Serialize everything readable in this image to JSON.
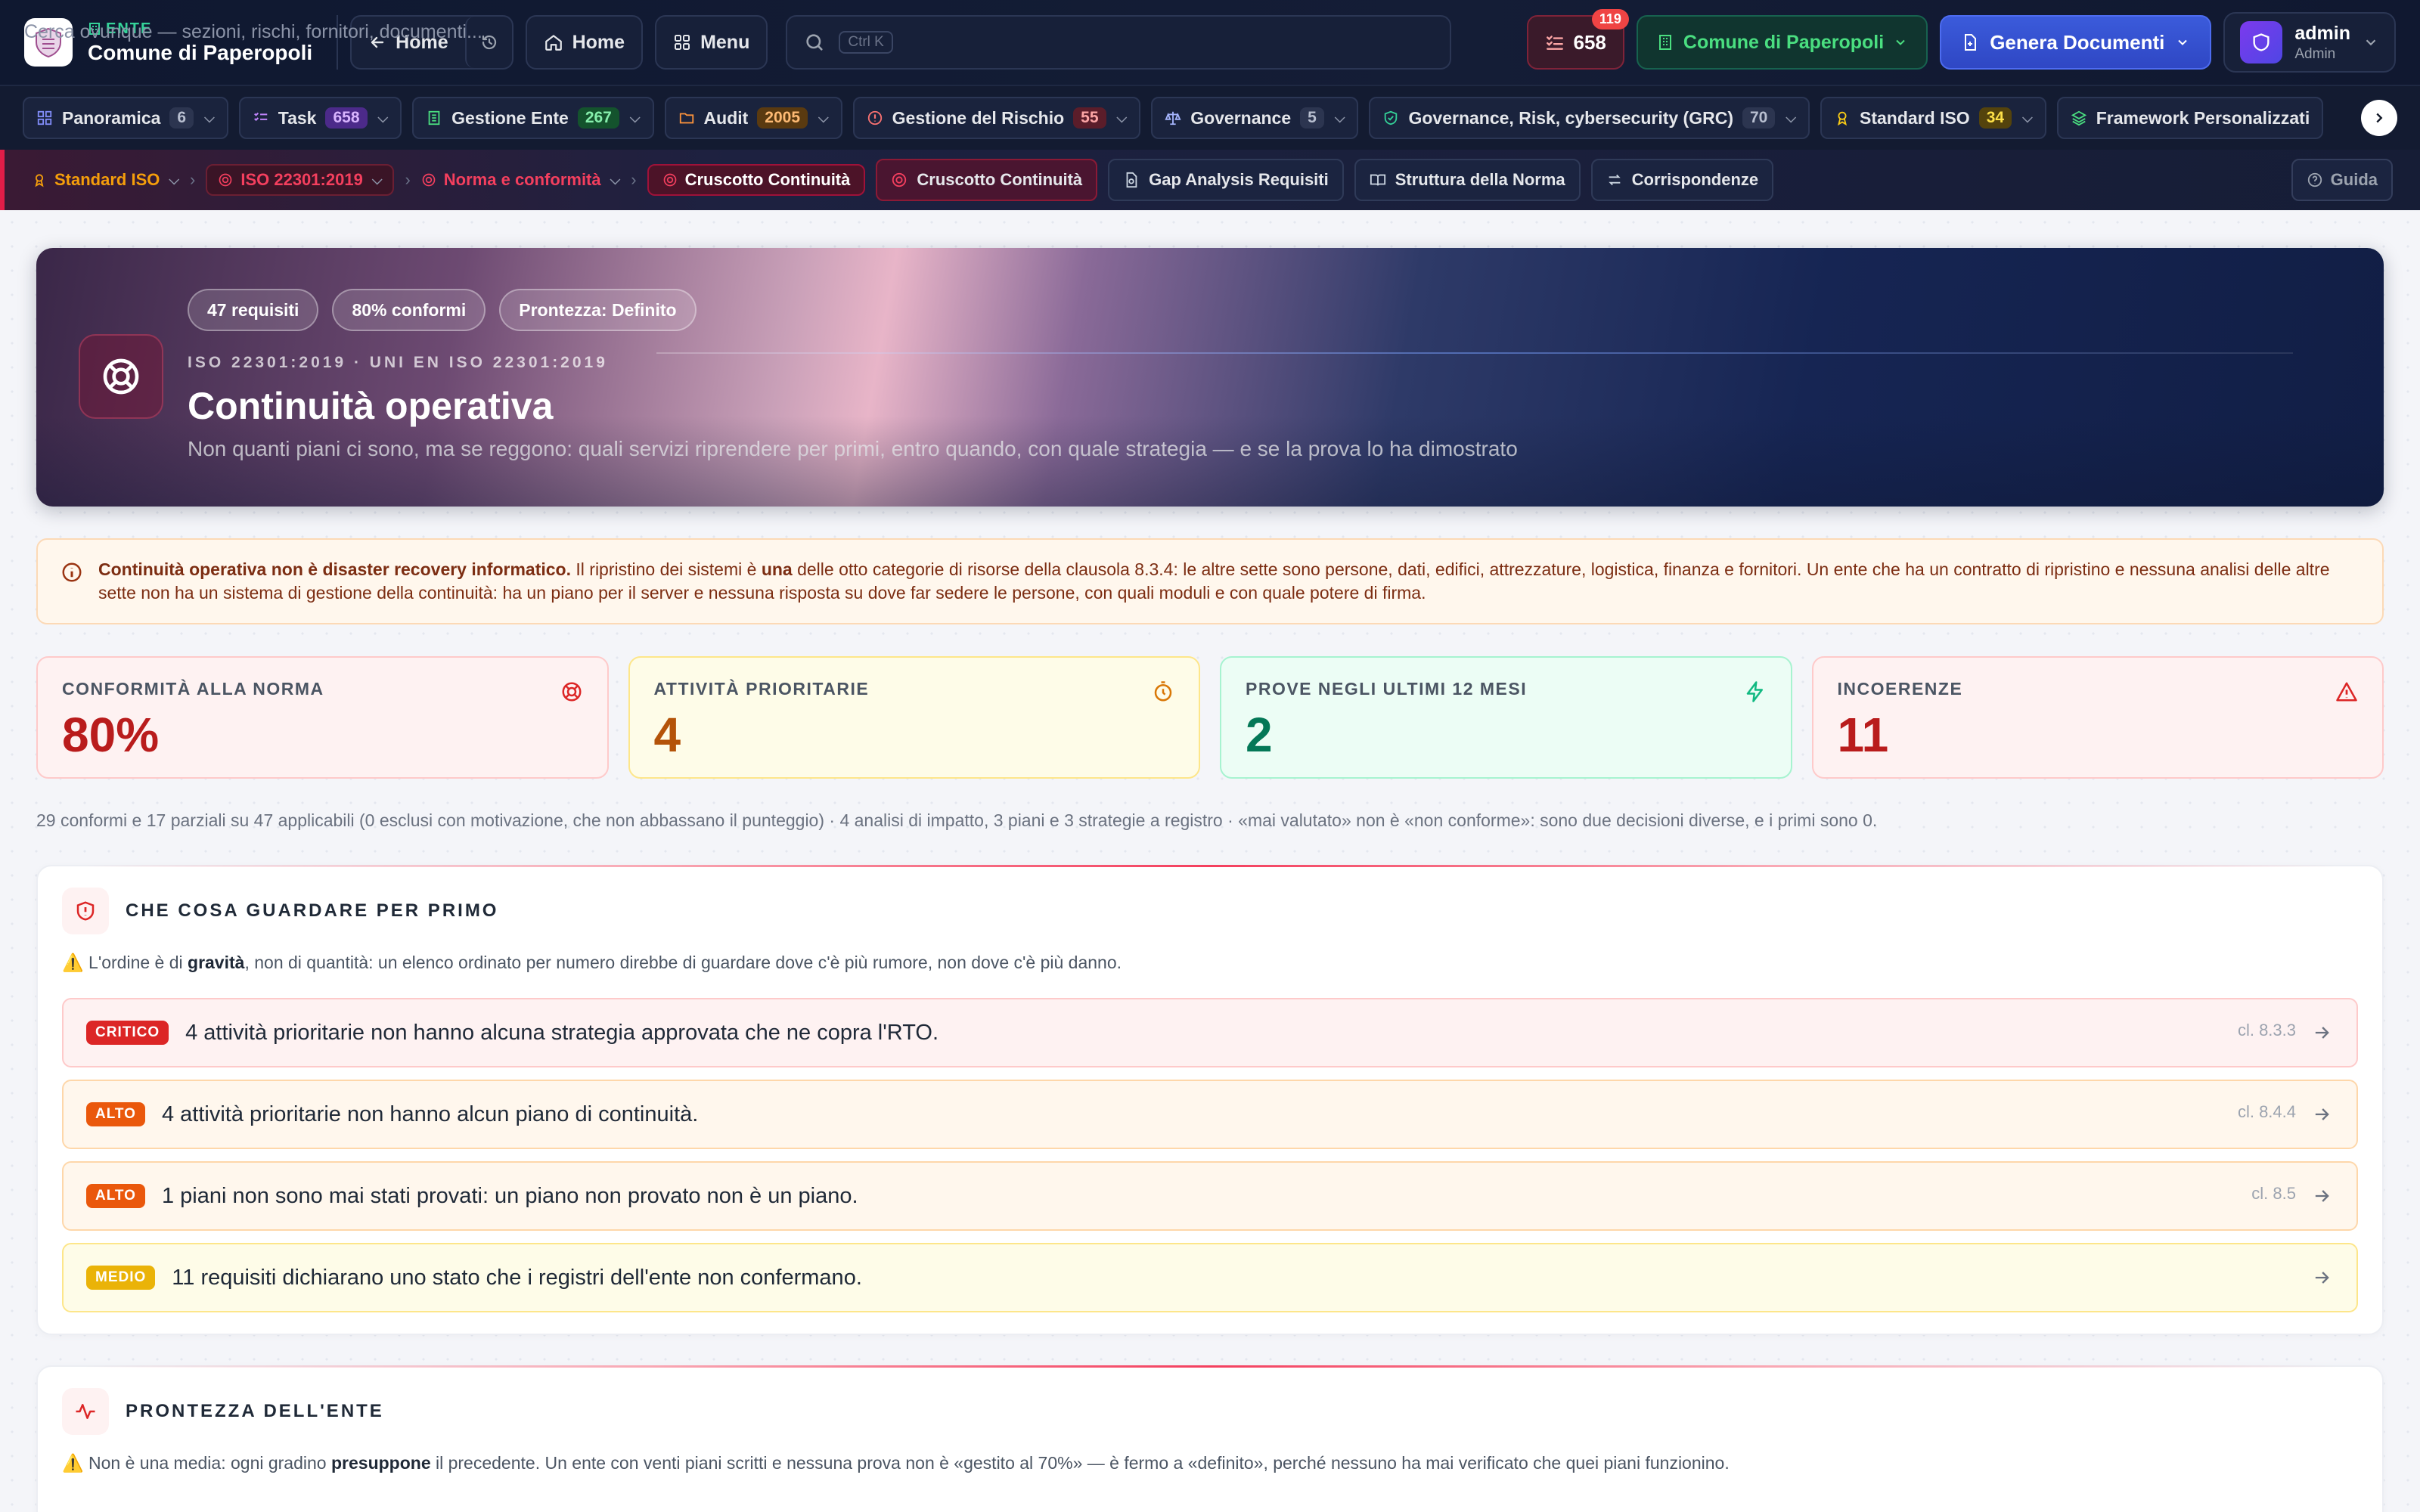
{
  "header": {
    "entity_kicker": "ENTE",
    "entity_name": "Comune di Paperopoli",
    "back_home": "Home",
    "home": "Home",
    "menu": "Menu",
    "search_placeholder": "Cerca ovunque — sezioni, rischi, fornitori, documenti...",
    "search_shortcut": "Ctrl K",
    "tasks_count": "658",
    "tasks_badge": "119",
    "entity_selector": "Comune di Paperopoli",
    "generate_docs": "Genera Documenti",
    "user_name": "admin",
    "user_role": "Admin"
  },
  "modules": [
    {
      "label": "Panoramica",
      "count": "6",
      "count_color": "gray",
      "icon": "grid-icon"
    },
    {
      "label": "Task",
      "count": "658",
      "count_color": "purple",
      "icon": "list-check-icon"
    },
    {
      "label": "Gestione Ente",
      "count": "267",
      "count_color": "green",
      "icon": "building-icon"
    },
    {
      "label": "Audit",
      "count": "2005",
      "count_color": "orange",
      "icon": "folder-icon"
    },
    {
      "label": "Gestione del Rischio",
      "count": "55",
      "count_color": "red",
      "icon": "alert-circle-icon"
    },
    {
      "label": "Governance",
      "count": "5",
      "count_color": "gray",
      "icon": "scale-icon"
    },
    {
      "label": "Governance, Risk, cybersecurity (GRC)",
      "count": "70",
      "count_color": "gray",
      "icon": "shield-check-icon"
    },
    {
      "label": "Standard ISO",
      "count": "34",
      "count_color": "yellow",
      "icon": "award-icon"
    },
    {
      "label": "Framework Personalizzati",
      "count": "",
      "count_color": "gray",
      "icon": "layers-icon"
    }
  ],
  "breadcrumb": {
    "root": "Standard ISO",
    "standard": "ISO 22301:2019",
    "section": "Norma e conformità",
    "current": "Cruscotto Continuità"
  },
  "tabs": [
    {
      "label": "Cruscotto Continuità",
      "icon": "lifebuoy-icon"
    },
    {
      "label": "Gap Analysis Requisiti",
      "icon": "file-search-icon"
    },
    {
      "label": "Struttura della Norma",
      "icon": "book-open-icon"
    },
    {
      "label": "Corrispondenze",
      "icon": "arrows-icon"
    }
  ],
  "guide": "Guida",
  "hero": {
    "chips": [
      "47 requisiti",
      "80% conformi",
      "Prontezza: Definito"
    ],
    "kicker": "ISO 22301:2019 · UNI EN ISO 22301:2019",
    "title": "Continuità operativa",
    "subtitle": "Non quanti piani ci sono, ma se reggono: quali servizi riprendere per primi, entro quando, con quale strategia — e se la prova lo ha dimostrato"
  },
  "note": {
    "bold": "Continuità operativa non è disaster recovery informatico.",
    "text_a": " Il ripristino dei sistemi è ",
    "bold2": "una",
    "text_b": " delle otto categorie di risorse della clausola 8.3.4: le altre sette sono persone, dati, edifici, attrezzature, logistica, finanza e fornitori. Un ente che ha un contratto di ripristino e nessuna analisi delle altre sette non ha un sistema di gestione della continuità: ha un piano per il server e nessuna risposta su dove far sedere le persone, con quali moduli e con quale potere di firma."
  },
  "kpis": [
    {
      "label": "CONFORMITÀ ALLA NORMA",
      "value": "80%",
      "icon": "lifebuoy-icon"
    },
    {
      "label": "ATTIVITÀ PRIORITARIE",
      "value": "4",
      "icon": "timer-icon"
    },
    {
      "label": "PROVE NEGLI ULTIMI 12 MESI",
      "value": "2",
      "icon": "zap-icon"
    },
    {
      "label": "INCOERENZE",
      "value": "11",
      "icon": "warning-icon"
    }
  ],
  "summary": "29 conformi e 17 parziali su 47 applicabili (0 esclusi con motivazione, che non abbassano il punteggio) · 4 analisi di impatto, 3 piani e 3 strategie a registro · «mai valutato» non è «non conforme»: sono due decisioni diverse, e i primi sono 0.",
  "priorities": {
    "title": "CHE COSA GUARDARE PER PRIMO",
    "note_a": "⚠️ L'ordine è di ",
    "note_bold": "gravità",
    "note_b": ", non di quantità: un elenco ordinato per numero direbbe di guardare dove c'è più rumore, non dove c'è più danno.",
    "items": [
      {
        "severity": "CRITICO",
        "text": "4 attività prioritarie non hanno alcuna strategia approvata che ne copra l'RTO.",
        "clause": "cl. 8.3.3"
      },
      {
        "severity": "ALTO",
        "text": "4 attività prioritarie non hanno alcun piano di continuità.",
        "clause": "cl. 8.4.4"
      },
      {
        "severity": "ALTO",
        "text": "1 piani non sono mai stati provati: un piano non provato non è un piano.",
        "clause": "cl. 8.5"
      },
      {
        "severity": "MEDIO",
        "text": "11 requisiti dichiarano uno stato che i registri dell'ente non confermano.",
        "clause": ""
      }
    ]
  },
  "readiness": {
    "title": "PRONTEZZA DELL'ENTE",
    "note_a": "⚠️ Non è una media: ogni gradino ",
    "note_bold": "presuppone",
    "note_b": " il precedente. Un ente con venti piani scritti e nessuna prova non è «gestito al 70%» — è fermo a «definito», perché nessuno ha mai verificato che quei piani funzionino.",
    "level_colors": [
      "#dc2626",
      "#ea580c",
      "#eab308",
      "#e5e7eb",
      "#e5e7eb"
    ]
  }
}
